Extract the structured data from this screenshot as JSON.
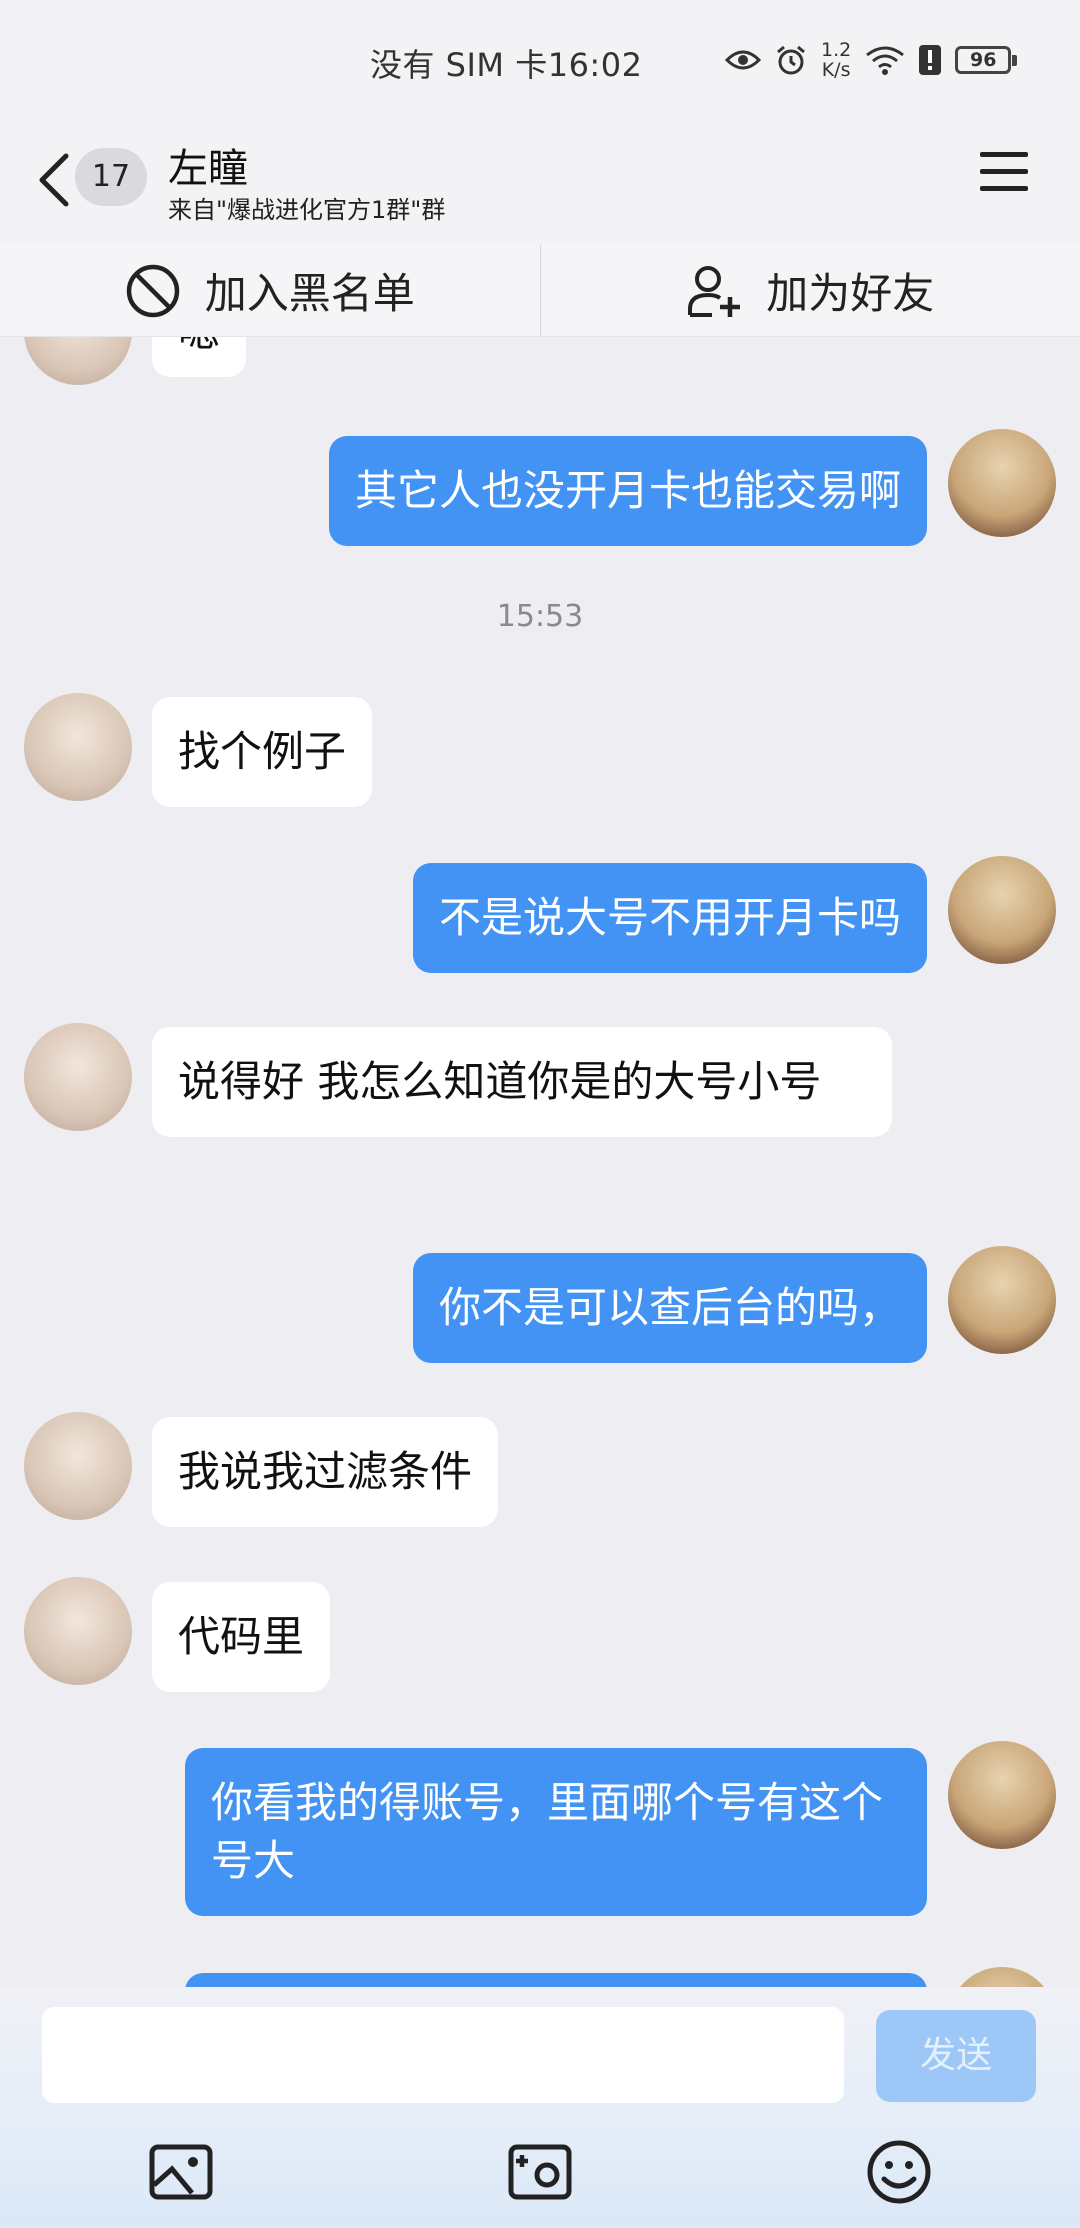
{
  "status_bar": {
    "carrier_time": "没有 SIM 卡16:02",
    "net_speed_value": "1.2",
    "net_speed_unit": "K/s",
    "battery": "96"
  },
  "header": {
    "unread_count": "17",
    "contact_name": "左瞳",
    "contact_source": "来自\"爆战进化官方1群\"群"
  },
  "actions": {
    "blacklist_label": "加入黑名单",
    "add_friend_label": "加为好友"
  },
  "messages": [
    {
      "sender": "other",
      "text": "嗯"
    },
    {
      "sender": "me",
      "text": "其它人也没开月卡也能交易啊"
    },
    {
      "type": "timestamp",
      "text": "15:53"
    },
    {
      "sender": "other",
      "text": "找个例子"
    },
    {
      "sender": "me",
      "text": "不是说大号不用开月卡吗"
    },
    {
      "sender": "other",
      "text": "说得好 我怎么知道你是的大号小号"
    },
    {
      "sender": "me",
      "text": "你不是可以查后台的吗，"
    },
    {
      "sender": "other",
      "text": "我说我过滤条件"
    },
    {
      "sender": "other",
      "text": "代码里"
    },
    {
      "sender": "me",
      "text": "你看我的得账号，里面哪个号有这个号大"
    }
  ],
  "input": {
    "value": "",
    "send_label": "发送"
  },
  "colors": {
    "my_bubble": "#4393f4",
    "other_bubble": "#ffffff",
    "background": "#ededf2",
    "send_disabled": "#9cc7f6"
  },
  "icons": [
    "back-icon",
    "menu-icon",
    "block-icon",
    "add-user-icon",
    "image-icon",
    "camera-icon",
    "emoji-icon"
  ]
}
